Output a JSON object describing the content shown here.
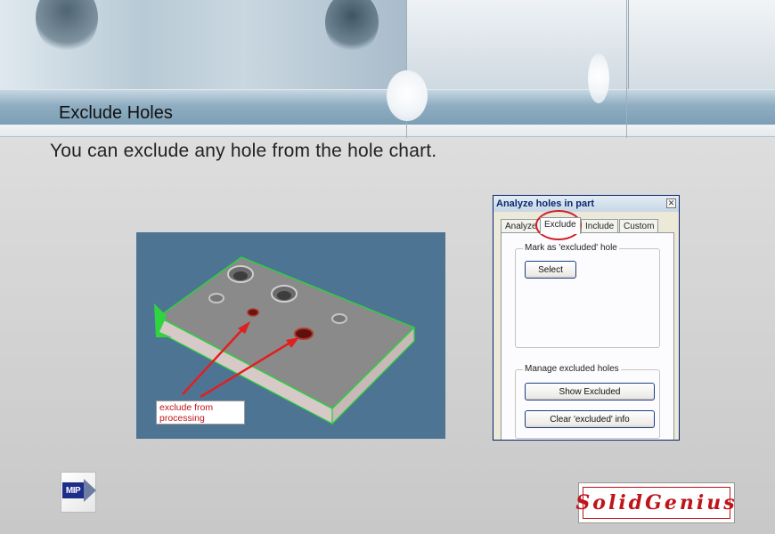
{
  "slide": {
    "title": "Exclude Holes",
    "subtitle": "You can exclude any hole from the hole chart."
  },
  "figure": {
    "callout": "exclude from processing"
  },
  "dialog": {
    "title": "Analyze holes in part",
    "close_label": "✕",
    "tabs": [
      {
        "label": "Analyze",
        "active": false
      },
      {
        "label": "Exclude",
        "active": true
      },
      {
        "label": "Include",
        "active": false
      },
      {
        "label": "Custom",
        "active": false
      }
    ],
    "mark_group_label": "Mark as 'excluded' hole",
    "select_button": "Select",
    "manage_group_label": "Manage excluded holes",
    "show_excluded_button": "Show Excluded",
    "clear_info_button": "Clear 'excluded' info"
  },
  "logos": {
    "left": "MIP",
    "right": "SolidGenius"
  },
  "colors": {
    "title_bar": "#8fadc1",
    "highlight": "#d0202a",
    "viewport_bg": "#4e7494",
    "part_outline": "#27d43a",
    "brand_red": "#c0141c"
  }
}
